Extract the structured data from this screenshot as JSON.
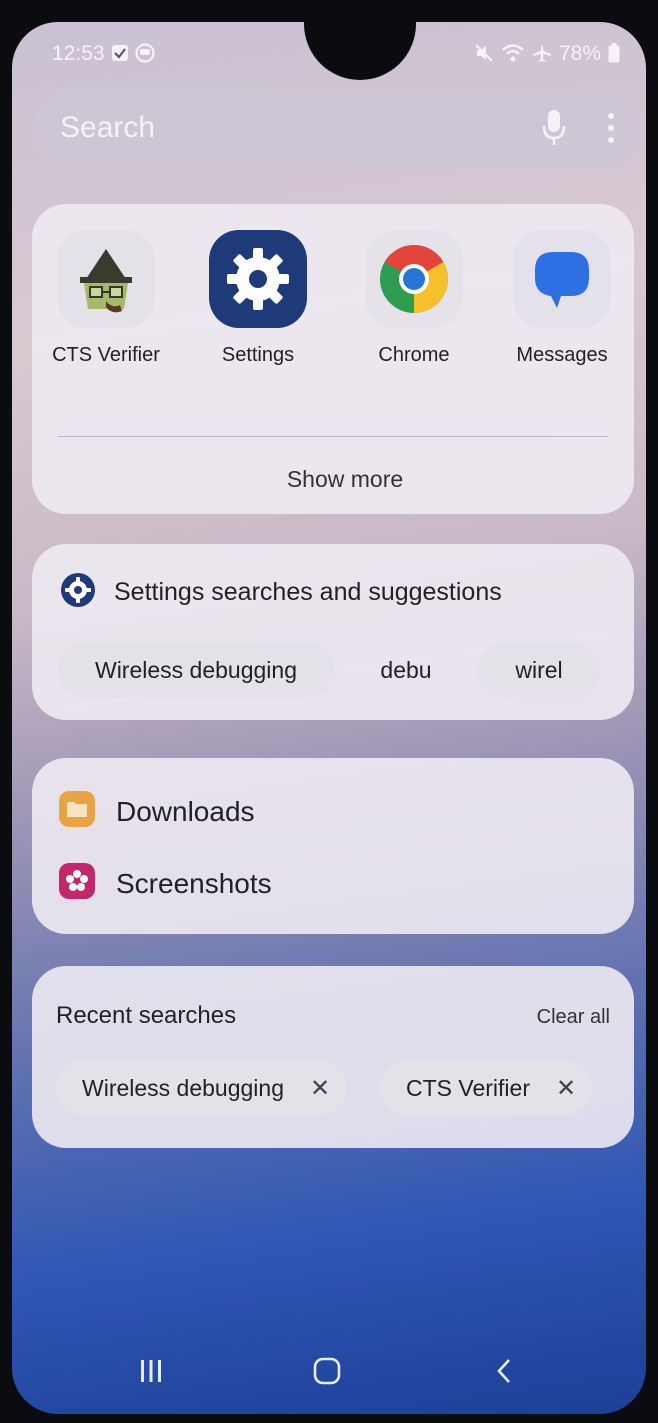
{
  "status_bar": {
    "time": "12:53",
    "battery": "78%",
    "icons_left": [
      "checkbox-notification-icon",
      "circle-notification-icon"
    ],
    "icons_right": [
      "mute-icon",
      "wifi-icon",
      "airplane-icon",
      "battery-icon"
    ]
  },
  "search": {
    "placeholder": "Search"
  },
  "apps": {
    "items": [
      {
        "label": "CTS Verifier",
        "icon": "cts-verifier-icon"
      },
      {
        "label": "Settings",
        "icon": "settings-gear-icon"
      },
      {
        "label": "Chrome",
        "icon": "chrome-icon"
      },
      {
        "label": "Messages",
        "icon": "messages-icon"
      }
    ],
    "show_more": "Show more"
  },
  "settings_suggestions": {
    "title": "Settings searches and suggestions",
    "chips": [
      "Wireless debugging",
      "debu",
      "wirel"
    ]
  },
  "files": {
    "items": [
      {
        "label": "Downloads",
        "icon": "folder-icon"
      },
      {
        "label": "Screenshots",
        "icon": "flower-icon"
      }
    ]
  },
  "recent_searches": {
    "title": "Recent searches",
    "clear_all": "Clear all",
    "items": [
      "Wireless debugging",
      "CTS Verifier"
    ]
  },
  "colors": {
    "accent": "#1f3a78",
    "chrome_red": "#e5443a",
    "chrome_yellow": "#f6c02c",
    "chrome_green": "#2e9d4f",
    "chrome_blue": "#2a74d6",
    "messages_blue": "#2f6fe4",
    "downloads_orange": "#e7a344",
    "screenshots_magenta": "#c2266b"
  }
}
